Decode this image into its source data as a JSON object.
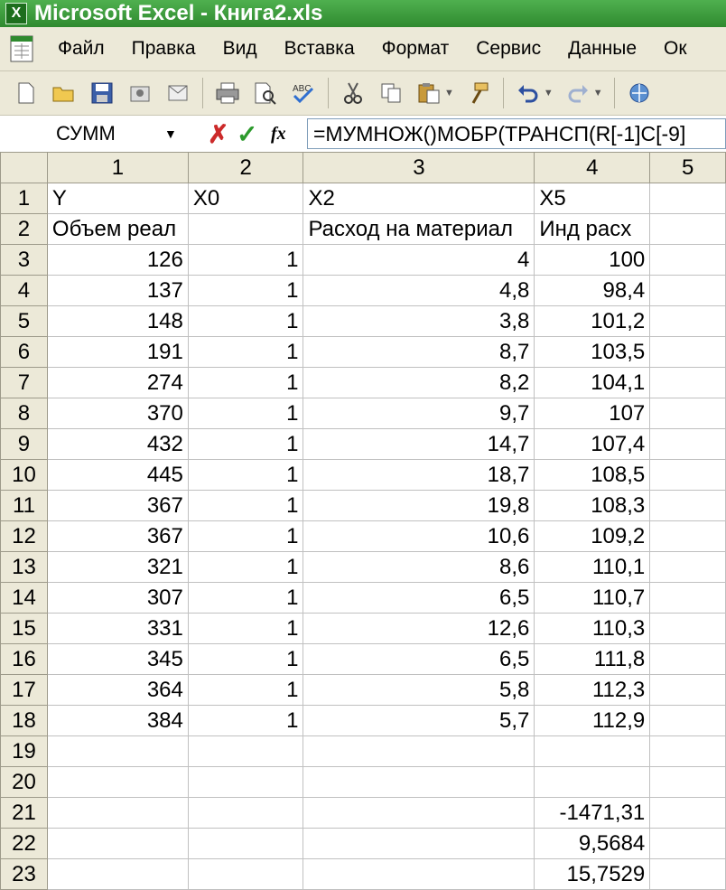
{
  "window": {
    "title": "Microsoft Excel - Книга2.xls",
    "app_icon": "X"
  },
  "menu": [
    "Файл",
    "Правка",
    "Вид",
    "Вставка",
    "Формат",
    "Сервис",
    "Данные",
    "Ок"
  ],
  "toolbar": {
    "icons": [
      "new-icon",
      "open-icon",
      "save-icon",
      "permission-icon",
      "email-icon",
      "print-icon",
      "print-preview-icon",
      "spelling-icon",
      "cut-icon",
      "copy-icon",
      "paste-icon",
      "format-painter-icon",
      "undo-icon",
      "redo-icon",
      "hyperlink-icon"
    ]
  },
  "formula_bar": {
    "name_box": "СУММ",
    "formula": "=МУМНОЖ()МОБР(ТРАНСП(R[-1]C[-9]",
    "fx_label": "fx"
  },
  "grid": {
    "columns": [
      "1",
      "2",
      "3",
      "4",
      "5"
    ],
    "rows": [
      {
        "n": "1",
        "c": [
          "Y",
          "X0",
          "X2",
          "X5",
          ""
        ]
      },
      {
        "n": "2",
        "c": [
          "Объем реал",
          "",
          "Расход на материал",
          "Инд расх",
          ""
        ]
      },
      {
        "n": "3",
        "c": [
          "126",
          "1",
          "4",
          "100",
          ""
        ]
      },
      {
        "n": "4",
        "c": [
          "137",
          "1",
          "4,8",
          "98,4",
          ""
        ]
      },
      {
        "n": "5",
        "c": [
          "148",
          "1",
          "3,8",
          "101,2",
          ""
        ]
      },
      {
        "n": "6",
        "c": [
          "191",
          "1",
          "8,7",
          "103,5",
          ""
        ]
      },
      {
        "n": "7",
        "c": [
          "274",
          "1",
          "8,2",
          "104,1",
          ""
        ]
      },
      {
        "n": "8",
        "c": [
          "370",
          "1",
          "9,7",
          "107",
          ""
        ]
      },
      {
        "n": "9",
        "c": [
          "432",
          "1",
          "14,7",
          "107,4",
          ""
        ]
      },
      {
        "n": "10",
        "c": [
          "445",
          "1",
          "18,7",
          "108,5",
          ""
        ]
      },
      {
        "n": "11",
        "c": [
          "367",
          "1",
          "19,8",
          "108,3",
          ""
        ]
      },
      {
        "n": "12",
        "c": [
          "367",
          "1",
          "10,6",
          "109,2",
          ""
        ]
      },
      {
        "n": "13",
        "c": [
          "321",
          "1",
          "8,6",
          "110,1",
          ""
        ]
      },
      {
        "n": "14",
        "c": [
          "307",
          "1",
          "6,5",
          "110,7",
          ""
        ]
      },
      {
        "n": "15",
        "c": [
          "331",
          "1",
          "12,6",
          "110,3",
          ""
        ]
      },
      {
        "n": "16",
        "c": [
          "345",
          "1",
          "6,5",
          "111,8",
          ""
        ]
      },
      {
        "n": "17",
        "c": [
          "364",
          "1",
          "5,8",
          "112,3",
          ""
        ]
      },
      {
        "n": "18",
        "c": [
          "384",
          "1",
          "5,7",
          "112,9",
          ""
        ]
      },
      {
        "n": "19",
        "c": [
          "",
          "",
          "",
          "",
          ""
        ]
      },
      {
        "n": "20",
        "c": [
          "",
          "",
          "",
          "",
          ""
        ]
      },
      {
        "n": "21",
        "c": [
          "",
          "",
          "",
          "-1471,31",
          ""
        ]
      },
      {
        "n": "22",
        "c": [
          "",
          "",
          "",
          "9,5684",
          ""
        ]
      },
      {
        "n": "23",
        "c": [
          "",
          "",
          "",
          "15,7529",
          ""
        ]
      }
    ]
  }
}
